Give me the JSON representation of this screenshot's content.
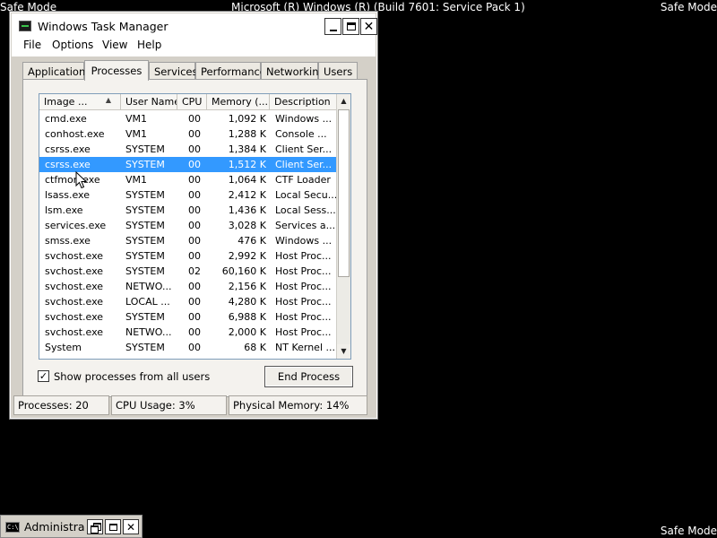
{
  "desktop": {
    "safe_mode_label": "Safe Mode",
    "build_text": "Microsoft (R) Windows (R) (Build 7601: Service Pack 1)"
  },
  "window": {
    "title": "Windows Task Manager",
    "menu": [
      "File",
      "Options",
      "View",
      "Help"
    ],
    "tabs": [
      "Applications",
      "Processes",
      "Services",
      "Performance",
      "Networking",
      "Users"
    ],
    "active_tab": "Processes"
  },
  "processes": {
    "columns": [
      "Image ...",
      "User Name",
      "CPU",
      "Memory (...",
      "Description"
    ],
    "rows": [
      {
        "name": "cmd.exe",
        "user": "VM1",
        "cpu": "00",
        "memory": "1,092 K",
        "description": "Windows ..."
      },
      {
        "name": "conhost.exe",
        "user": "VM1",
        "cpu": "00",
        "memory": "1,288 K",
        "description": "Console ..."
      },
      {
        "name": "csrss.exe",
        "user": "SYSTEM",
        "cpu": "00",
        "memory": "1,384 K",
        "description": "Client Ser..."
      },
      {
        "name": "csrss.exe",
        "user": "SYSTEM",
        "cpu": "00",
        "memory": "1,512 K",
        "description": "Client Ser..."
      },
      {
        "name": "ctfmon.exe",
        "user": "VM1",
        "cpu": "00",
        "memory": "1,064 K",
        "description": "CTF Loader"
      },
      {
        "name": "lsass.exe",
        "user": "SYSTEM",
        "cpu": "00",
        "memory": "2,412 K",
        "description": "Local Secu..."
      },
      {
        "name": "lsm.exe",
        "user": "SYSTEM",
        "cpu": "00",
        "memory": "1,436 K",
        "description": "Local Sess..."
      },
      {
        "name": "services.exe",
        "user": "SYSTEM",
        "cpu": "00",
        "memory": "3,028 K",
        "description": "Services a..."
      },
      {
        "name": "smss.exe",
        "user": "SYSTEM",
        "cpu": "00",
        "memory": "476 K",
        "description": "Windows ..."
      },
      {
        "name": "svchost.exe",
        "user": "SYSTEM",
        "cpu": "00",
        "memory": "2,992 K",
        "description": "Host Proc..."
      },
      {
        "name": "svchost.exe",
        "user": "SYSTEM",
        "cpu": "02",
        "memory": "60,160 K",
        "description": "Host Proc..."
      },
      {
        "name": "svchost.exe",
        "user": "NETWO...",
        "cpu": "00",
        "memory": "2,156 K",
        "description": "Host Proc..."
      },
      {
        "name": "svchost.exe",
        "user": "LOCAL ...",
        "cpu": "00",
        "memory": "4,280 K",
        "description": "Host Proc..."
      },
      {
        "name": "svchost.exe",
        "user": "SYSTEM",
        "cpu": "00",
        "memory": "6,988 K",
        "description": "Host Proc..."
      },
      {
        "name": "svchost.exe",
        "user": "NETWO...",
        "cpu": "00",
        "memory": "2,000 K",
        "description": "Host Proc..."
      },
      {
        "name": "System",
        "user": "SYSTEM",
        "cpu": "00",
        "memory": "68 K",
        "description": "NT Kernel ..."
      }
    ],
    "selected_row": 3,
    "show_all_users_label": "Show processes from all users",
    "show_all_users_checked": true,
    "show_all_users_check_glyph": "✓",
    "end_process_label": "End Process"
  },
  "status": {
    "processes": "Processes: 20",
    "cpu": "CPU Usage: 3%",
    "memory": "Physical Memory: 14%"
  },
  "minimized_window": {
    "title": "Administra...",
    "icon_text": "C:\\"
  },
  "colors": {
    "selection": "#3399ff",
    "desktop": "#000000",
    "window_face": "#d4d0c8"
  }
}
